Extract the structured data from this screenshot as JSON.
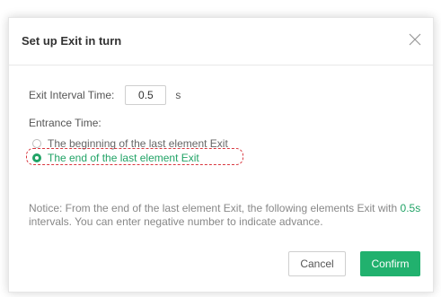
{
  "dialog": {
    "title": "Set up Exit in turn",
    "close_icon": "close-icon"
  },
  "interval": {
    "label": "Exit Interval Time:",
    "value": "0.5",
    "unit": "s"
  },
  "entrance": {
    "label": "Entrance Time:",
    "options": [
      {
        "label": "The beginning of the last element Exit",
        "selected": false
      },
      {
        "label": "The end of the last element Exit",
        "selected": true
      }
    ]
  },
  "notice": {
    "prefix": "Notice: From the end of the last element Exit, the following elements Exit with",
    "value": "0.5s",
    "suffix": "intervals. You can enter negative number to indicate advance."
  },
  "buttons": {
    "cancel": "Cancel",
    "confirm": "Confirm"
  },
  "colors": {
    "accent": "#21a366",
    "highlight": "#d9363e"
  }
}
